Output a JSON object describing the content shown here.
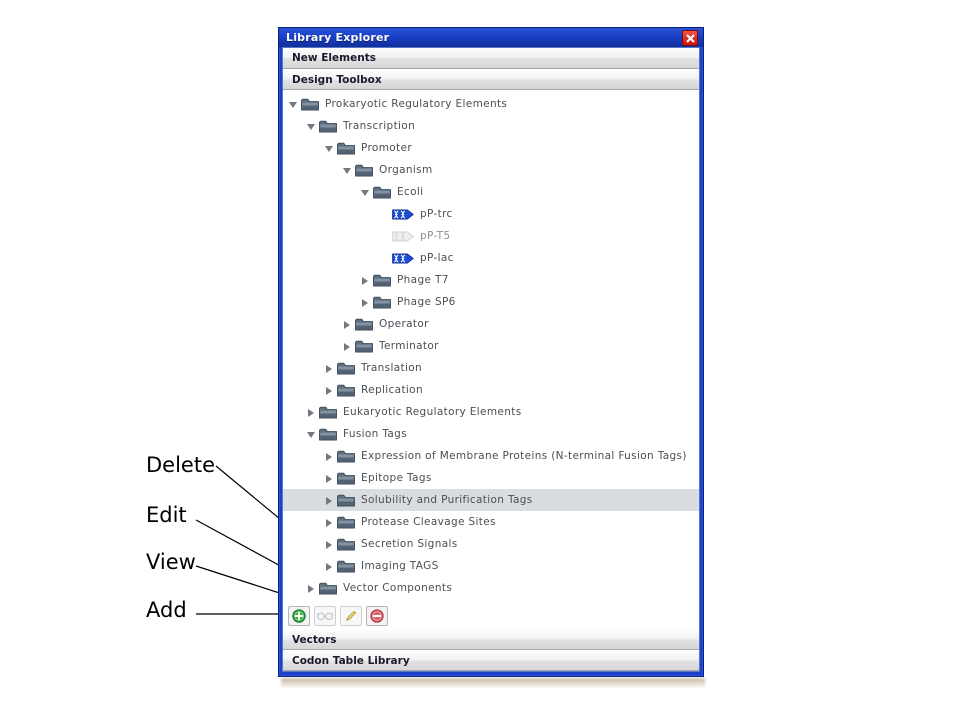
{
  "window": {
    "title": "Library Explorer",
    "close_icon": "close-x-icon"
  },
  "sections": {
    "new_elements": "New Elements",
    "design_toolbox": "Design Toolbox",
    "vectors": "Vectors",
    "codon_table_library": "Codon Table Library"
  },
  "tree": [
    {
      "label": "Prokaryotic Regulatory Elements",
      "depth": 0,
      "icon": "folder-icon",
      "state": "open",
      "selected": false
    },
    {
      "label": "Transcription",
      "depth": 1,
      "icon": "folder-icon",
      "state": "open",
      "selected": false
    },
    {
      "label": "Promoter",
      "depth": 2,
      "icon": "folder-icon",
      "state": "open",
      "selected": false
    },
    {
      "label": "Organism",
      "depth": 3,
      "icon": "folder-icon",
      "state": "open",
      "selected": false
    },
    {
      "label": "Ecoli",
      "depth": 4,
      "icon": "folder-icon",
      "state": "open",
      "selected": false
    },
    {
      "label": "pP-trc",
      "depth": 5,
      "icon": "dna-part-icon",
      "state": "leaf",
      "selected": false,
      "enabled": true
    },
    {
      "label": "pP-T5",
      "depth": 5,
      "icon": "dna-part-icon-disabled",
      "state": "leaf",
      "selected": false,
      "enabled": false
    },
    {
      "label": "pP-lac",
      "depth": 5,
      "icon": "dna-part-icon",
      "state": "leaf",
      "selected": false,
      "enabled": true
    },
    {
      "label": "Phage T7",
      "depth": 4,
      "icon": "folder-icon",
      "state": "closed",
      "selected": false
    },
    {
      "label": "Phage SP6",
      "depth": 4,
      "icon": "folder-icon",
      "state": "closed",
      "selected": false
    },
    {
      "label": "Operator",
      "depth": 3,
      "icon": "folder-icon",
      "state": "closed",
      "selected": false
    },
    {
      "label": "Terminator",
      "depth": 3,
      "icon": "folder-icon",
      "state": "closed",
      "selected": false
    },
    {
      "label": "Translation",
      "depth": 2,
      "icon": "folder-icon",
      "state": "closed",
      "selected": false
    },
    {
      "label": "Replication",
      "depth": 2,
      "icon": "folder-icon",
      "state": "closed",
      "selected": false
    },
    {
      "label": "Eukaryotic Regulatory Elements",
      "depth": 1,
      "icon": "folder-icon",
      "state": "closed",
      "selected": false
    },
    {
      "label": "Fusion Tags",
      "depth": 1,
      "icon": "folder-icon",
      "state": "open",
      "selected": false
    },
    {
      "label": "Expression of Membrane Proteins (N-terminal Fusion Tags)",
      "depth": 2,
      "icon": "folder-icon",
      "state": "closed",
      "selected": false
    },
    {
      "label": "Epitope Tags",
      "depth": 2,
      "icon": "folder-icon",
      "state": "closed",
      "selected": false
    },
    {
      "label": "Solubility and Purification Tags",
      "depth": 2,
      "icon": "folder-icon",
      "state": "closed",
      "selected": true
    },
    {
      "label": "Protease Cleavage Sites",
      "depth": 2,
      "icon": "folder-icon",
      "state": "closed",
      "selected": false
    },
    {
      "label": "Secretion Signals",
      "depth": 2,
      "icon": "folder-icon",
      "state": "closed",
      "selected": false
    },
    {
      "label": "Imaging TAGS",
      "depth": 2,
      "icon": "folder-icon",
      "state": "closed",
      "selected": false
    },
    {
      "label": "Vector Components",
      "depth": 1,
      "icon": "folder-icon",
      "state": "closed",
      "selected": false
    }
  ],
  "toolbar": {
    "buttons": [
      {
        "name": "add-button",
        "icon": "plus-circle-green-icon",
        "enabled": true
      },
      {
        "name": "view-button",
        "icon": "glasses-icon",
        "enabled": false
      },
      {
        "name": "edit-button",
        "icon": "pencil-icon",
        "enabled": true
      },
      {
        "name": "delete-button",
        "icon": "minus-circle-red-icon",
        "enabled": true
      }
    ]
  },
  "annotations": [
    {
      "id": "delete",
      "text": "Delete"
    },
    {
      "id": "edit",
      "text": "Edit"
    },
    {
      "id": "view",
      "text": "View"
    },
    {
      "id": "add",
      "text": "Add"
    }
  ],
  "colors": {
    "titlebar_blue": "#1b3fc8",
    "window_border_blue": "#1c3fcd",
    "selection_gray": "#d9dde1",
    "folder_slate": "#5b6b7c",
    "dna_blue": "#1b4fd8",
    "add_green": "#2fa83c",
    "delete_red": "#d9606a"
  }
}
